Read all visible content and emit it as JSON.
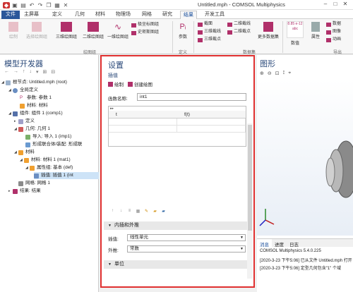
{
  "window": {
    "title": "Untitled.mph - COMSOL Multiphysics"
  },
  "menu_tabs": [
    {
      "label": "文件"
    },
    {
      "label": "主屏幕"
    },
    {
      "label": "定义"
    },
    {
      "label": "几何"
    },
    {
      "label": "材料"
    },
    {
      "label": "物理场"
    },
    {
      "label": "网格"
    },
    {
      "label": "研究"
    },
    {
      "label": "结果"
    },
    {
      "label": "开发工具"
    }
  ],
  "ribbon": {
    "draw": "绘制",
    "select_plot": "选择绘图组",
    "plot3d": "三维绘图组",
    "plot2d": "二维绘图组",
    "plot1d": "一维绘图组",
    "polar": "极坐标图组",
    "smith": "史密斯图组",
    "group_plots": "绘图组",
    "param": "参数",
    "group_def": "定义",
    "cutplane": "截面",
    "cutline3d": "三维截线",
    "cutpoint3d": "三维截点",
    "cutline2d": "二维截线",
    "cutpoint2d": "二维截点",
    "more_datasets": "更多数据集",
    "group_data": "数据集",
    "num_icon": "8.85 e-12 abc",
    "numeric": "数值",
    "properties": "属性",
    "data": "数据",
    "image": "图像",
    "animation": "动画",
    "group_export": "导出"
  },
  "model_builder": {
    "title": "模型开发器",
    "tree": [
      {
        "label": "根节点: Untitled.mph (root)"
      },
      {
        "label": "全局定义"
      },
      {
        "label": "参数: 参数 1"
      },
      {
        "label": "材料: 材料"
      },
      {
        "label": "组件: 组件 1 (comp1)"
      },
      {
        "label": "定义"
      },
      {
        "label": "几何: 几何 1"
      },
      {
        "label": "导入: 导入 1 (imp1)"
      },
      {
        "label": "形成联合体/装配: 形成联"
      },
      {
        "label": "材料"
      },
      {
        "label": "材料: 材料 1 (mat1)"
      },
      {
        "label": "属性组: 基本 (def)"
      },
      {
        "label": "插值: 插值 1 (int"
      },
      {
        "label": "网格: 网格 1"
      },
      {
        "label": "结果: 结果"
      }
    ]
  },
  "settings": {
    "title": "设置",
    "subtitle": "插值",
    "plot_btn": "绘制",
    "create_plot_btn": "创建绘图",
    "function_name_label": "函数名称:",
    "function_name_value": "int1",
    "table_headers": [
      "t",
      "f(t)"
    ],
    "section_interp": "内插和外推",
    "interp_label": "插值:",
    "interp_value": "线性单元",
    "extrap_label": "外推:",
    "extrap_value": "常数",
    "section_units": "单位"
  },
  "graphics": {
    "title": "图形",
    "messages_tab": "消息",
    "progress_tab": "进度",
    "log_tab": "日志",
    "log_lines": [
      "COMSOL Multiphysics 5.4.0.225",
      "[2020-3-23 下午5:06] 已从文件 Untitled.mph 打开",
      "[2020-3-23 下午5:06] 定型几何包含\"1\" 个域"
    ]
  }
}
